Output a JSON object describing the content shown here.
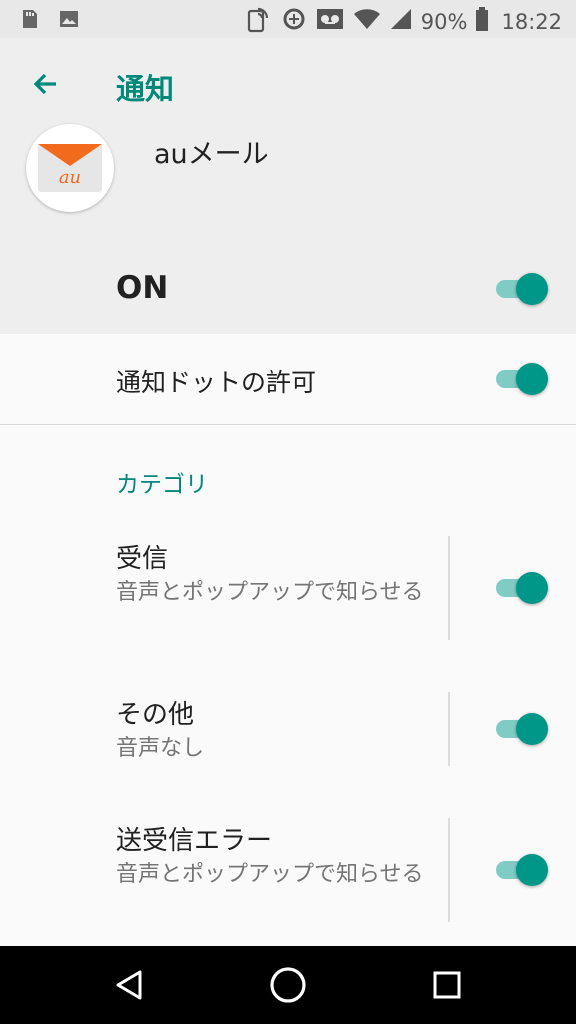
{
  "status_bar": {
    "battery_percent": "90%",
    "time": "18:22",
    "left_icons": [
      "sd-card-icon",
      "image-icon"
    ],
    "right_icons": [
      "nfc-icon",
      "data-saver-icon",
      "voicemail-icon",
      "wifi-icon",
      "signal-icon",
      "battery-icon"
    ]
  },
  "header": {
    "title": "通知",
    "app_name": "auメール",
    "app_icon_text": "au",
    "master_switch_label": "ON",
    "master_switch_on": true
  },
  "notification_dot": {
    "label": "通知ドットの許可",
    "on": true
  },
  "category_header": "カテゴリ",
  "categories": [
    {
      "title": "受信",
      "subtitle": "音声とポップアップで知らせる",
      "on": true
    },
    {
      "title": "その他",
      "subtitle": "音声なし",
      "on": true
    },
    {
      "title": "送受信エラー",
      "subtitle": "音声とポップアップで知らせる",
      "on": true
    }
  ],
  "colors": {
    "accent": "#00897b",
    "switch_thumb": "#009688",
    "switch_track": "#80cbc4",
    "app_icon_orange": "#f26a1b"
  },
  "nav_bar": {
    "buttons": [
      "back-icon",
      "home-icon",
      "recents-icon"
    ]
  }
}
